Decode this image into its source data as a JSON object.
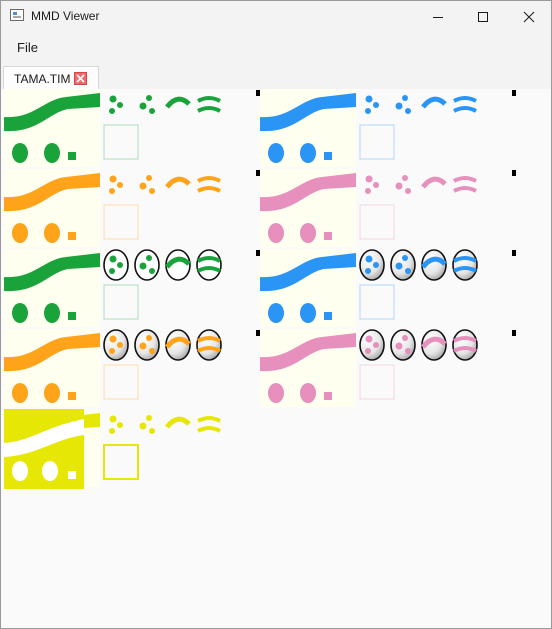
{
  "window": {
    "title": "MMD Viewer",
    "minimize_label": "Minimize",
    "maximize_label": "Maximize",
    "close_label": "Close"
  },
  "menu": {
    "items": [
      {
        "label": "File"
      }
    ]
  },
  "tabs": [
    {
      "label": "TAMA.TIM",
      "active": true
    }
  ],
  "sheet": {
    "background": "#fffff0",
    "palettes": [
      {
        "name": "green",
        "color": "#1aa33a"
      },
      {
        "name": "blue",
        "color": "#2a95f4"
      },
      {
        "name": "orange",
        "color": "#ffa31a"
      },
      {
        "name": "pink",
        "color": "#e78fbd"
      },
      {
        "name": "yellow",
        "color": "#e7e705"
      }
    ]
  }
}
